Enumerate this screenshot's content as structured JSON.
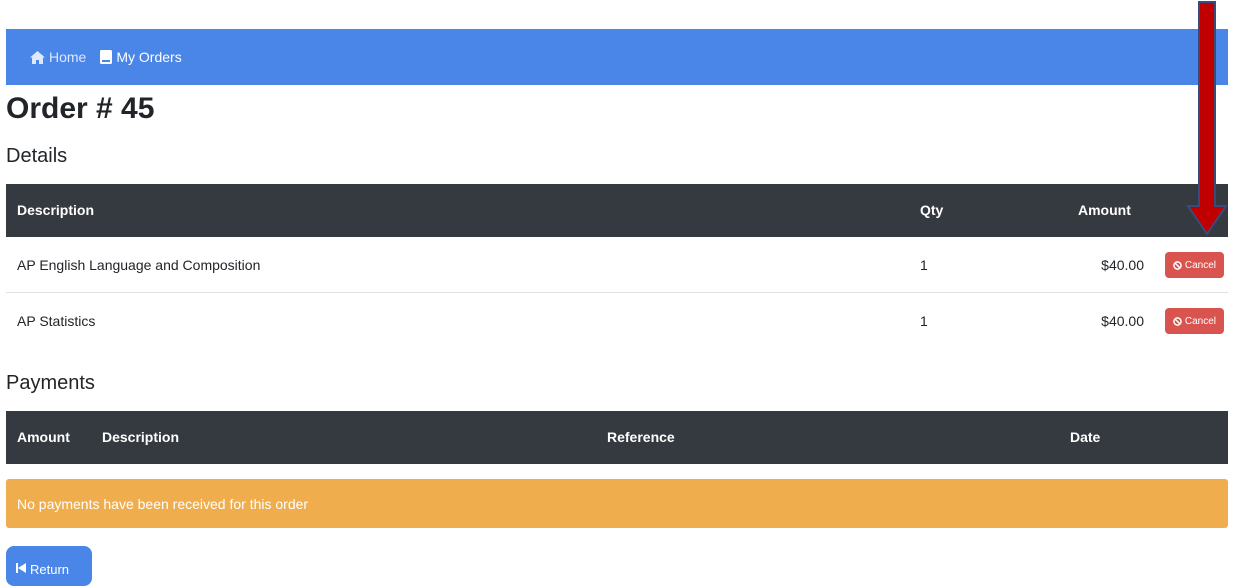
{
  "nav": {
    "home_label": "Home",
    "orders_label": "My Orders"
  },
  "page_title": "Order # 45",
  "details": {
    "section_title": "Details",
    "headers": {
      "description": "Description",
      "qty": "Qty",
      "amount": "Amount"
    },
    "rows": [
      {
        "description": "AP English Language and Composition",
        "qty": "1",
        "amount": "$40.00",
        "action": "Cancel"
      },
      {
        "description": "AP Statistics",
        "qty": "1",
        "amount": "$40.00",
        "action": "Cancel"
      }
    ]
  },
  "payments": {
    "section_title": "Payments",
    "headers": {
      "amount": "Amount",
      "description": "Description",
      "reference": "Reference",
      "date": "Date"
    },
    "empty_message": "No payments have been received for this order"
  },
  "return_label": "Return",
  "colors": {
    "navbar": "#4a86e8",
    "table_header": "#343a40",
    "cancel": "#d9534f",
    "warning": "#f0ad4e",
    "arrow": "#c00000"
  },
  "icons": {
    "home": "home-icon",
    "orders": "book-icon",
    "cancel": "ban-icon",
    "return": "step-backward-icon",
    "annotation": "down-arrow-icon"
  }
}
